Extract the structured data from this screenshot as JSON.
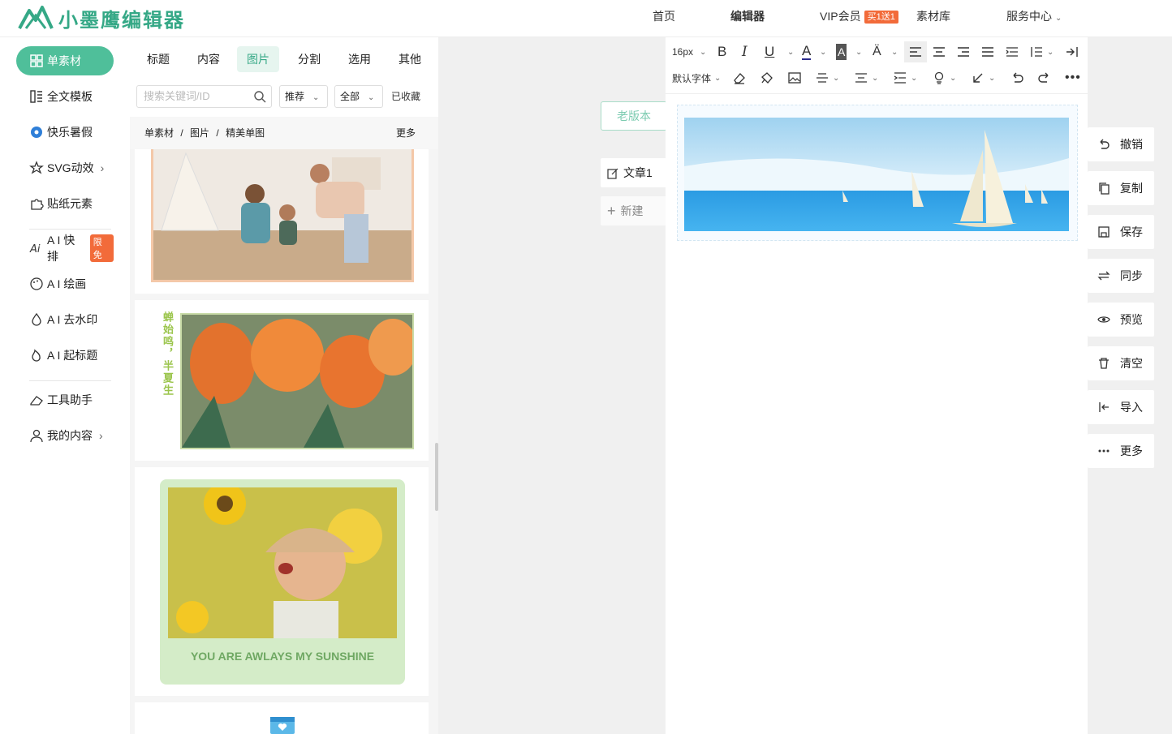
{
  "app": {
    "logo_text": "小墨鹰编辑器"
  },
  "topnav": {
    "home": "首页",
    "editor": "编辑器",
    "vip": "VIP会员",
    "vip_badge": "买1送1",
    "library": "素材库",
    "service": "服务中心"
  },
  "leftnav": {
    "items": [
      {
        "label": "单素材"
      },
      {
        "label": "全文模板"
      },
      {
        "label": "快乐暑假"
      },
      {
        "label": "SVG动效"
      },
      {
        "label": "贴纸元素"
      },
      {
        "label": "A I 快排",
        "badge": "限免"
      },
      {
        "label": "A I 绘画"
      },
      {
        "label": "A I 去水印"
      },
      {
        "label": "A I 起标题"
      },
      {
        "label": "工具助手"
      },
      {
        "label": "我的内容"
      }
    ]
  },
  "panel": {
    "tabs": [
      "标题",
      "内容",
      "图片",
      "分割",
      "选用",
      "其他"
    ],
    "search_placeholder": "搜索关键词/ID",
    "filter_recommend": "推荐",
    "filter_all": "全部",
    "favorites": "已收藏",
    "breadcrumb": [
      "单素材",
      "图片",
      "精美单图"
    ],
    "more": "更多",
    "card2_vertical_text": "蝉始鸣，半夏生",
    "card3_caption": "YOU ARE AWLAYS MY SUNSHINE"
  },
  "workspace": {
    "old_version": "老版本",
    "article": "文章1",
    "new": "新建"
  },
  "toolbar": {
    "font_size": "16px",
    "font_family": "默认字体"
  },
  "right_actions": [
    "撤销",
    "复制",
    "保存",
    "同步",
    "预览",
    "清空",
    "导入",
    "更多"
  ],
  "colors": {
    "accent": "#4fbf9a",
    "badge": "#f26b3a"
  }
}
